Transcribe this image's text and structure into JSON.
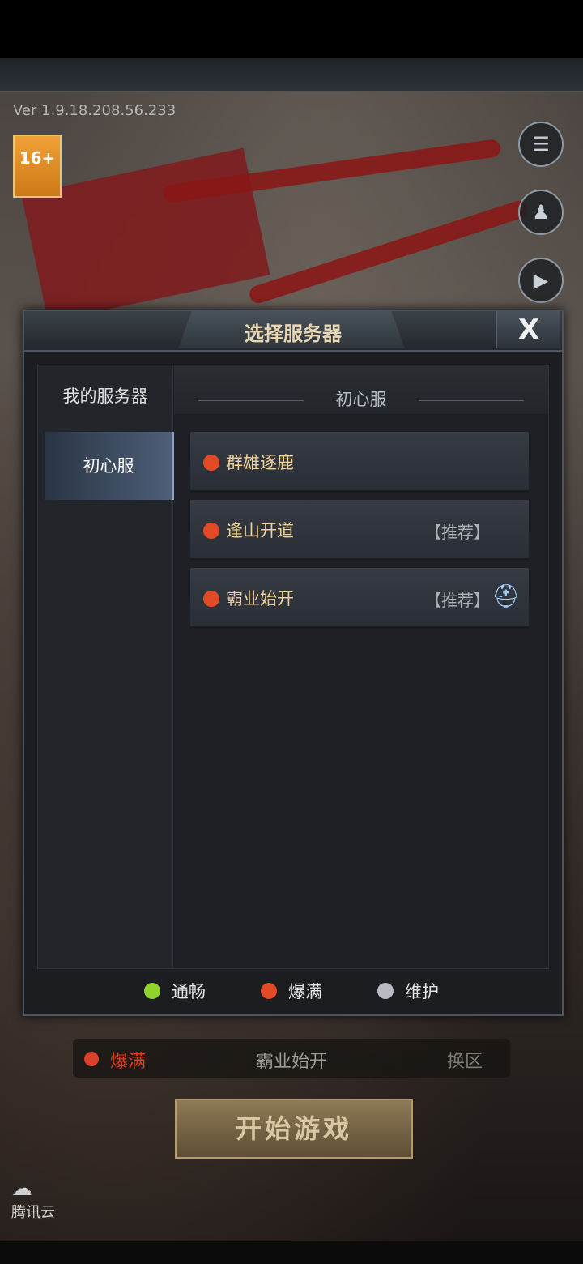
{
  "version": "Ver 1.9.18.208.56.233",
  "age_rating": "16+",
  "dialog": {
    "title": "选择服务器",
    "close_label": "X",
    "sidebar": {
      "my_servers": "我的服务器",
      "selected_group": "初心服"
    },
    "group_title": "初心服",
    "servers": [
      {
        "name": "群雄逐鹿",
        "tag": "",
        "status_color": "#e24a25"
      },
      {
        "name": "逢山开道",
        "tag": "【推荐】",
        "status_color": "#e24a25"
      },
      {
        "name": "霸业始开",
        "tag": "【推荐】",
        "status_color": "#e24a25"
      }
    ],
    "legend": [
      {
        "label": "通畅",
        "color": "#8fd32c"
      },
      {
        "label": "爆满",
        "color": "#e24a25"
      },
      {
        "label": "维护",
        "color": "#b8bcc2"
      }
    ]
  },
  "background": {
    "status": "爆满",
    "server": "霸业始开",
    "change": "换区",
    "start_button": "开始游戏",
    "tencent_logo": "腾讯云"
  }
}
